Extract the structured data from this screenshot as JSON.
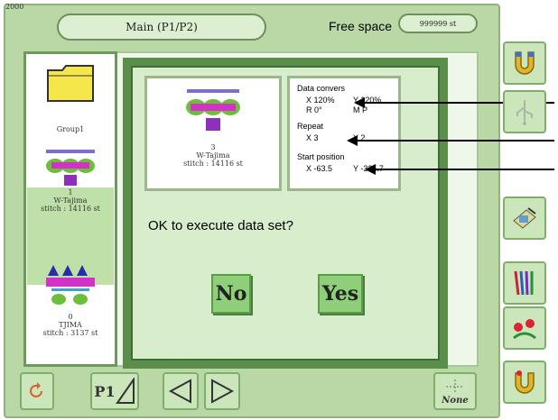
{
  "screen": {
    "code": "2000",
    "title": "Main (P1/P2)",
    "free_space_label": "Free space",
    "free_space_value": "999999 st"
  },
  "list": {
    "items": [
      {
        "label": "Group1"
      },
      {
        "number": "1",
        "name": "W-Tajima",
        "stitch": "stitch : 14116 st"
      },
      {
        "number": "0",
        "name": "TJIMA",
        "stitch": "stitch : 3137 st"
      }
    ]
  },
  "dialog": {
    "thumb": {
      "number": "3",
      "name": "W-Tajima",
      "stitch": "stitch : 14116 st"
    },
    "info": {
      "data_conversion_label": "Data convers",
      "x_scale": "X  120%",
      "y_scale": "Y 120%",
      "rotation": "R   0°",
      "mirror": "M   P",
      "repeat_label": "Repeat",
      "repeat_x": "X  3",
      "repeat_y": "Y  2",
      "start_label": "Start position",
      "start_x": "X  -63.5",
      "start_y": "Y  -325.7"
    },
    "question": "OK to execute data set?",
    "no_label": "No",
    "yes_label": "Yes"
  },
  "bottom": {
    "p1_label": "P1",
    "none_label": "None"
  },
  "icons": [
    "magnet-icon",
    "usb-icon",
    "edit-icon",
    "threads-icon",
    "flowers-icon",
    "undo-icon",
    "back-icon",
    "prev-icon",
    "next-icon"
  ],
  "colors": {
    "frame": "#b9d8a6",
    "dialog_border": "#5a8e4a",
    "button": "#8fcf7a"
  }
}
